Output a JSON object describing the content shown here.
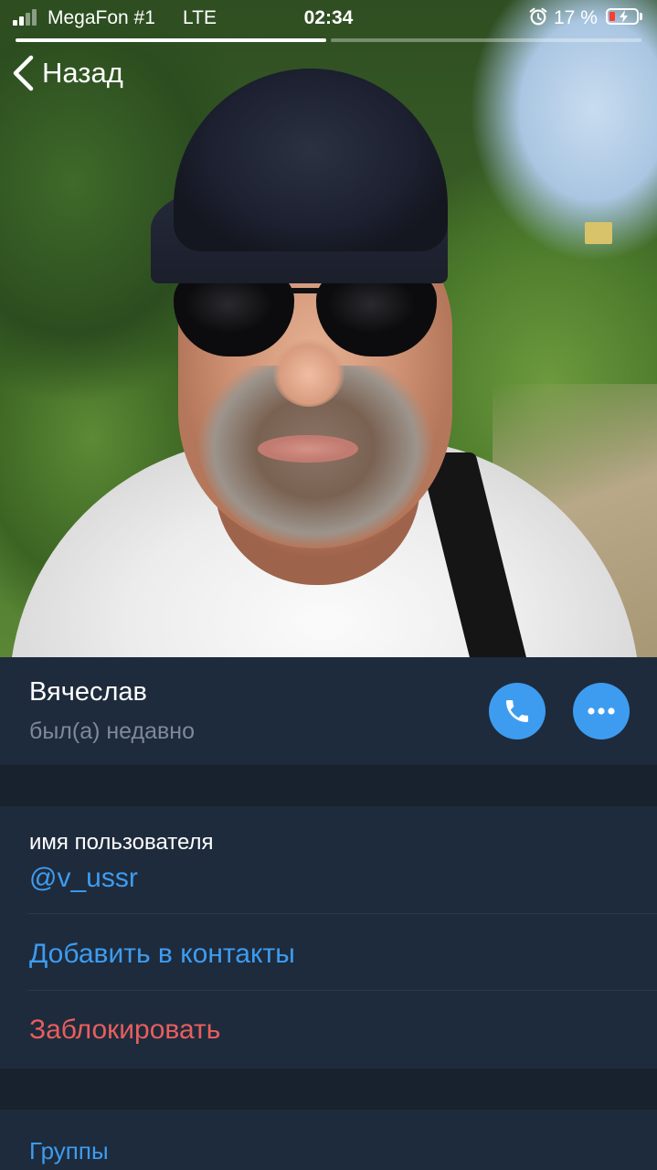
{
  "status_bar": {
    "carrier": "MegaFon #1",
    "network": "LTE",
    "time": "02:34",
    "battery_percent": "17 %",
    "signal_bars": 4,
    "signal_active": 2
  },
  "nav": {
    "back_label": "Назад"
  },
  "profile": {
    "name": "Вячеслав",
    "last_seen": "был(а) недавно"
  },
  "info_section": {
    "username_label": "имя пользователя",
    "username": "@v_ussr",
    "add_contact": "Добавить в контакты",
    "block": "Заблокировать"
  },
  "groups_section": {
    "groups_label": "Группы"
  },
  "colors": {
    "accent": "#3d9cf0",
    "danger": "#e85e5e",
    "panel": "#1e2b3c",
    "background": "#18222e"
  }
}
